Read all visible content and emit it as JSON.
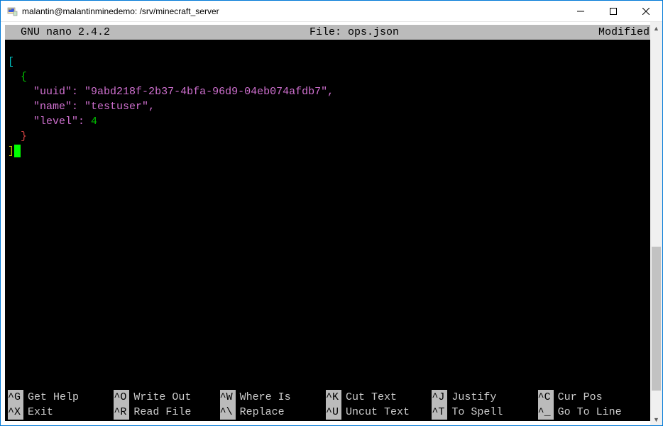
{
  "window": {
    "title": "malantin@malantinminedemo: /srv/minecraft_server"
  },
  "nano": {
    "app": "  GNU nano 2.4.2",
    "file_label": "File: ops.json",
    "modified": "Modified"
  },
  "file": {
    "lines": [
      {
        "tokens": [
          {
            "t": "[",
            "c": "teal"
          }
        ]
      },
      {
        "tokens": [
          {
            "t": "  ",
            "c": ""
          },
          {
            "t": "{",
            "c": "green"
          }
        ]
      },
      {
        "tokens": [
          {
            "t": "    ",
            "c": ""
          },
          {
            "t": "\"uuid\"",
            "c": "magenta"
          },
          {
            "t": ": ",
            "c": "magenta"
          },
          {
            "t": "\"9abd218f-2b37-4bfa-96d9-04eb074afdb7\"",
            "c": "magenta"
          },
          {
            "t": ",",
            "c": "magenta"
          }
        ]
      },
      {
        "tokens": [
          {
            "t": "    ",
            "c": ""
          },
          {
            "t": "\"name\"",
            "c": "magenta"
          },
          {
            "t": ": ",
            "c": "magenta"
          },
          {
            "t": "\"testuser\"",
            "c": "magenta"
          },
          {
            "t": ",",
            "c": "magenta"
          }
        ]
      },
      {
        "tokens": [
          {
            "t": "    ",
            "c": ""
          },
          {
            "t": "\"level\"",
            "c": "magenta"
          },
          {
            "t": ": ",
            "c": "magenta"
          },
          {
            "t": "4",
            "c": "green"
          }
        ]
      },
      {
        "tokens": [
          {
            "t": "  ",
            "c": ""
          },
          {
            "t": "}",
            "c": "red"
          }
        ]
      },
      {
        "tokens": [
          {
            "t": "]",
            "c": "yellow"
          }
        ],
        "cursor_after": true
      }
    ]
  },
  "footer": {
    "rows": [
      [
        {
          "key": "^G",
          "label": "Get Help"
        },
        {
          "key": "^O",
          "label": "Write Out"
        },
        {
          "key": "^W",
          "label": "Where Is"
        },
        {
          "key": "^K",
          "label": "Cut Text"
        },
        {
          "key": "^J",
          "label": "Justify"
        },
        {
          "key": "^C",
          "label": "Cur Pos"
        }
      ],
      [
        {
          "key": "^X",
          "label": "Exit"
        },
        {
          "key": "^R",
          "label": "Read File"
        },
        {
          "key": "^\\",
          "label": "Replace"
        },
        {
          "key": "^U",
          "label": "Uncut Text"
        },
        {
          "key": "^T",
          "label": "To Spell"
        },
        {
          "key": "^_",
          "label": "Go To Line"
        }
      ]
    ]
  }
}
